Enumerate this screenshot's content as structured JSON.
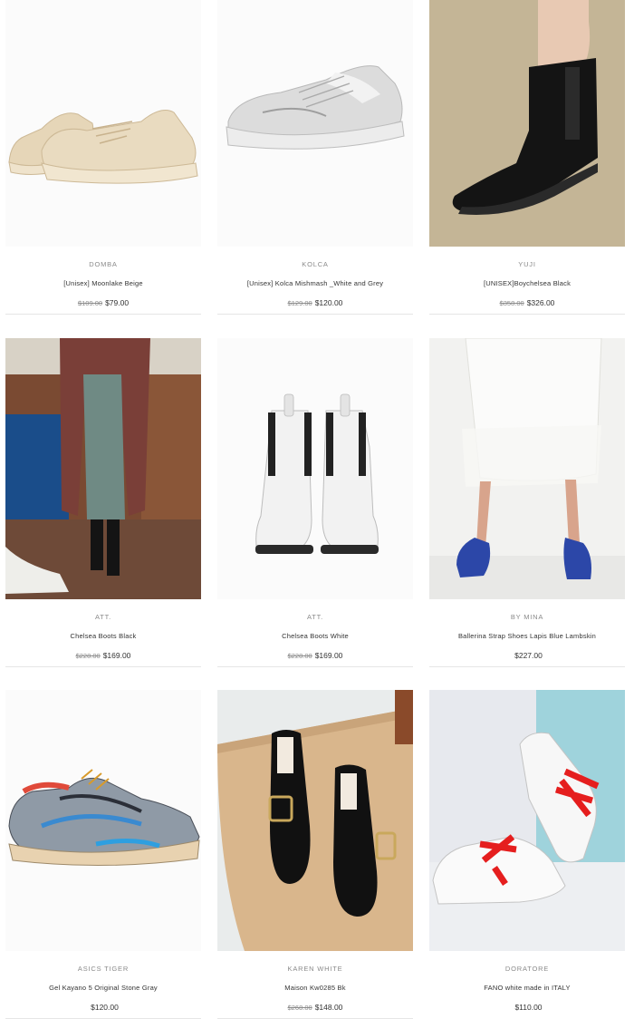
{
  "products": [
    {
      "brand": "DOMBA",
      "title": "[Unisex] Moonlake Beige",
      "old_price": "$109.00",
      "price": "$79.00",
      "image": "beige-chunky-sneakers"
    },
    {
      "brand": "KOLCA",
      "title": "[Unisex] Kolca Mishmash _White and Grey",
      "old_price": "$129.00",
      "price": "$120.00",
      "image": "grey-white-sneaker"
    },
    {
      "brand": "YUJI",
      "title": "[UNISEX]Boychelsea Black",
      "old_price": "$358.00",
      "price": "$326.00",
      "image": "black-chelsea-boot-on-rug"
    },
    {
      "brand": "ATT.",
      "title": "Chelsea Boots Black",
      "old_price": "$228.00",
      "price": "$169.00",
      "image": "model-in-coat-black-boots"
    },
    {
      "brand": "ATT.",
      "title": "Chelsea Boots White",
      "old_price": "$228.00",
      "price": "$169.00",
      "image": "white-chelsea-boots"
    },
    {
      "brand": "BY MINA",
      "title": "Ballerina Strap Shoes Lapis Blue Lambskin",
      "old_price": "",
      "price": "$227.00",
      "image": "blue-ballerina-shoes-model"
    },
    {
      "brand": "ASICS TIGER",
      "title": "Gel Kayano 5 Original Stone Gray",
      "old_price": "",
      "price": "$120.00",
      "image": "asics-gel-kayano-sneaker"
    },
    {
      "brand": "KAREN WHITE",
      "title": "Maison Kw0285 Bk",
      "old_price": "$268.00",
      "price": "$148.00",
      "image": "black-buckle-mules-on-mat"
    },
    {
      "brand": "DORATORE",
      "title": "FANO white made in ITALY",
      "old_price": "",
      "price": "$110.00",
      "image": "white-sneakers-red-laces"
    }
  ],
  "colors": {
    "accent": "#333333",
    "muted": "#8a8a8a",
    "divider": "#e6e6e6"
  }
}
